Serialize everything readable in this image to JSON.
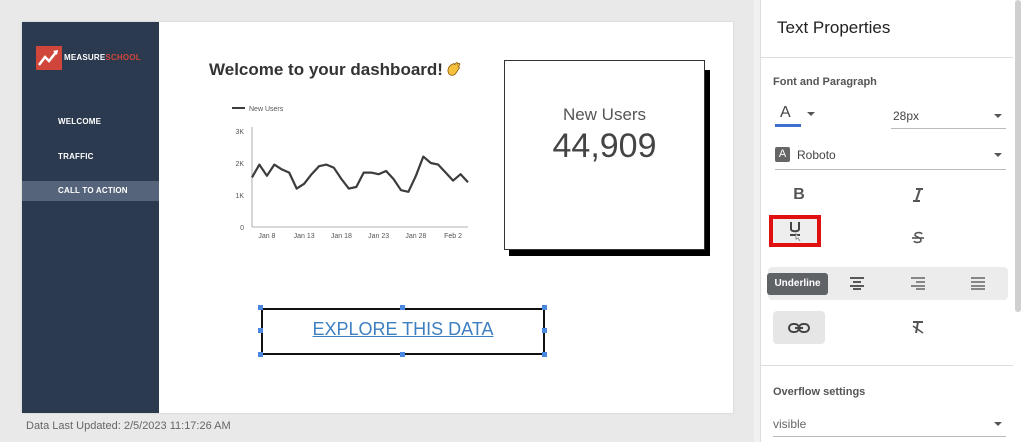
{
  "report": {
    "logo_text_white": "MEASURE",
    "logo_text_accent": "SCHOOL",
    "nav": [
      {
        "label": "WELCOME"
      },
      {
        "label": "TRAFFIC"
      },
      {
        "label": "CALL TO ACTION",
        "active": true
      }
    ],
    "title": "Welcome to your dashboard!",
    "title_emoji": "waving-hand-emoji",
    "last_updated": "Data Last Updated: 2/5/2023 11:17:26 AM"
  },
  "chart_data": {
    "type": "line",
    "legend": "New Users",
    "x_labels": [
      "Jan 8",
      "Jan 13",
      "Jan 18",
      "Jan 23",
      "Jan 28",
      "Feb 2"
    ],
    "y_ticks": [
      "0",
      "1K",
      "2K",
      "3K"
    ],
    "ylim": [
      0,
      3000
    ],
    "series": [
      {
        "name": "New Users",
        "x": [
          "Jan 6",
          "Jan 7",
          "Jan 8",
          "Jan 9",
          "Jan 10",
          "Jan 11",
          "Jan 12",
          "Jan 13",
          "Jan 14",
          "Jan 15",
          "Jan 16",
          "Jan 17",
          "Jan 18",
          "Jan 19",
          "Jan 20",
          "Jan 21",
          "Jan 22",
          "Jan 23",
          "Jan 24",
          "Jan 25",
          "Jan 26",
          "Jan 27",
          "Jan 28",
          "Jan 29",
          "Jan 30",
          "Jan 31",
          "Feb 1",
          "Feb 2",
          "Feb 3",
          "Feb 4"
        ],
        "values": [
          1550,
          1950,
          1600,
          1950,
          1800,
          1700,
          1200,
          1350,
          1650,
          1900,
          1950,
          1850,
          1500,
          1200,
          1250,
          1700,
          1700,
          1650,
          1750,
          1500,
          1150,
          1100,
          1600,
          2200,
          2000,
          1950,
          1700,
          1450,
          1650,
          1400
        ],
        "color": "#3c3c3c"
      }
    ]
  },
  "scorecard": {
    "label": "New Users",
    "value": "44,909"
  },
  "explore": {
    "text": "EXPLORE THIS DATA",
    "color": "#3d7fc1"
  },
  "panel": {
    "title": "Text Properties",
    "font_section": "Font and Paragraph",
    "font_color_glyph": "A",
    "font_color": "#3b6fd1",
    "font_size": "28px",
    "font_family": "Roboto",
    "font_family_glyph": "A",
    "bold_icon": "bold-icon",
    "italic_icon": "italic-icon",
    "underline_icon": "underline-icon",
    "strike_icon": "strikethrough-icon",
    "tooltip": "Underline",
    "overflow_section": "Overflow settings",
    "overflow_value": "visible",
    "highlight_color": "#e01010"
  }
}
